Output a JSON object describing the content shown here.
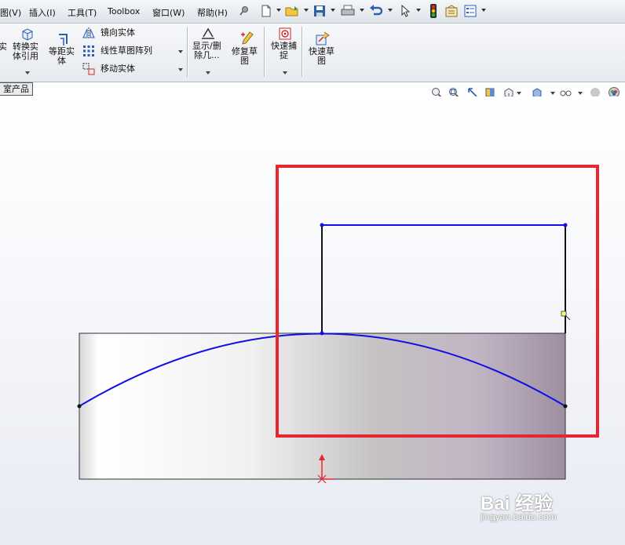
{
  "menu": {
    "items": [
      "图(V)",
      "插入(I)",
      "工具(T)",
      "Toolbox",
      "窗口(W)",
      "帮助(H)"
    ]
  },
  "ribbon": {
    "partial_left": "实",
    "convert_entities": "转换实\n体引用",
    "offset_entities": "等距实\n体",
    "mirror_entities": "镜向实体",
    "linear_pattern": "线性草图阵列",
    "move_entities": "移动实体",
    "display_delete": "显示/删\n除几...",
    "repair_sketch": "修复草\n图",
    "quick_snaps": "快速捕\n捉",
    "rapid_sketch": "快速草\n图"
  },
  "tabs": {
    "active": "室产品"
  },
  "watermark": {
    "logo": "Bai 经验",
    "url": "jingyan.baidu.com"
  },
  "colors": {
    "sketch_blue": "#1010e6",
    "highlight_red": "#e8262f",
    "accent": "#2a5fb0"
  }
}
